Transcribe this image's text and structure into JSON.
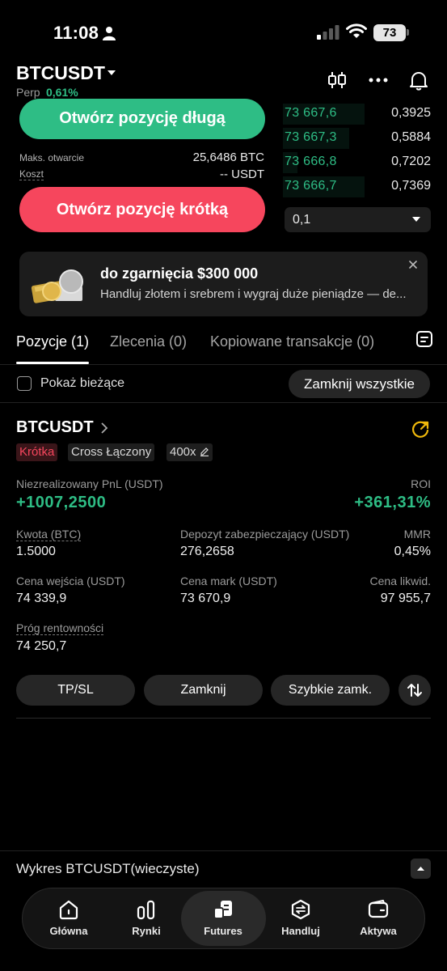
{
  "status_bar": {
    "time": "11:08",
    "battery": "73"
  },
  "header": {
    "pair": "BTCUSDT",
    "perp_label": "Perp",
    "change": "0,61%"
  },
  "order_book": [
    {
      "price": "73 667,6",
      "qty": "0,3925",
      "depth": 0.55
    },
    {
      "price": "73 667,3",
      "qty": "0,5884",
      "depth": 0.45
    },
    {
      "price": "73 666,8",
      "qty": "0,7202",
      "depth": 0.1
    },
    {
      "price": "73 666,7",
      "qty": "0,7369",
      "depth": 0.55
    }
  ],
  "order_panel": {
    "open_long": "Otwórz pozycję długą",
    "max_open_label": "Maks. otwarcie",
    "max_open_value": "25,6486 BTC",
    "cost_label": "Koszt",
    "cost_value": "-- USDT",
    "open_short": "Otwórz pozycję krótką",
    "qty_value": "0,1"
  },
  "promo": {
    "title": "do zgarnięcia $300 000",
    "text": "Handluj złotem i srebrem i wygraj duże pieniądze — de..."
  },
  "tabs": [
    {
      "label": "Pozycje (1)"
    },
    {
      "label": "Zlecenia (0)"
    },
    {
      "label": "Kopiowane transakcje (0)"
    }
  ],
  "filters": {
    "show_current": "Pokaż bieżące",
    "close_all": "Zamknij wszystkie"
  },
  "position": {
    "symbol": "BTCUSDT",
    "side": "Krótka",
    "margin_mode": "Cross Łączony",
    "leverage": "400x",
    "unrealized_pnl_label": "Niezrealizowany PnL (USDT)",
    "unrealized_pnl_value": "+1007,2500",
    "roi_label": "ROI",
    "roi_value": "+361,31%",
    "amount_label": "Kwota (BTC)",
    "amount_value": "1.5000",
    "margin_label": "Depozyt zabezpieczający (USDT)",
    "margin_value": "276,2658",
    "mmr_label": "MMR",
    "mmr_value": "0,45%",
    "entry_label": "Cena wejścia (USDT)",
    "entry_value": "74 339,9",
    "mark_label": "Cena mark (USDT)",
    "mark_value": "73 670,9",
    "liq_label": "Cena likwid.",
    "liq_value": "97 955,7",
    "breakeven_label": "Próg rentowności",
    "breakeven_value": "74 250,7",
    "actions": {
      "tpsl": "TP/SL",
      "close": "Zamknij",
      "quick_close": "Szybkie zamk."
    }
  },
  "chart_bar": {
    "label": "Wykres BTCUSDT(wieczyste)"
  },
  "bottom_nav": [
    {
      "label": "Główna",
      "icon": "home-icon"
    },
    {
      "label": "Rynki",
      "icon": "markets-icon"
    },
    {
      "label": "Futures",
      "icon": "futures-icon",
      "active": true
    },
    {
      "label": "Handluj",
      "icon": "trade-icon"
    },
    {
      "label": "Aktywa",
      "icon": "wallet-icon"
    }
  ],
  "colors": {
    "green": "#2ebd85",
    "red": "#f6465d",
    "background": "#000000"
  }
}
